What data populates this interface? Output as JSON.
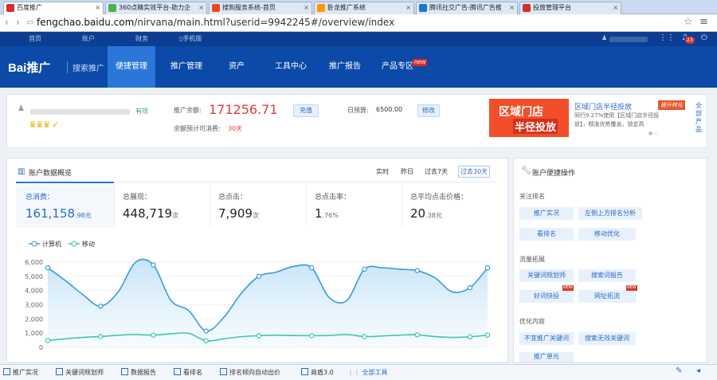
{
  "browser": {
    "tabs": [
      {
        "label": "百度推广",
        "fav": "#d32f2f"
      },
      {
        "label": "360点睛实效平台-助力企",
        "fav": "#4caf50"
      },
      {
        "label": "搜狗服务系统-首页",
        "fav": "#e64a19"
      },
      {
        "label": "卧龙推广系统",
        "fav": "#ff9800"
      },
      {
        "label": "腾讯社交广告-腾讯广告推",
        "fav": "#1976d2"
      },
      {
        "label": "投放管理平台",
        "fav": "#d32f2f"
      }
    ],
    "url_domain": "fengchao.baidu.com",
    "url_path": "/nirvana/main.html?userid=9942245#/overview/index"
  },
  "topnav": {
    "items": [
      "首页",
      "账户",
      "财务",
      "手机版"
    ],
    "notification_count": "23"
  },
  "mainnav": {
    "logo": "Bai推广",
    "logo_sub": "搜索推广",
    "items": [
      "便捷管理",
      "推广管理",
      "资产",
      "工具中心",
      "推广报告",
      "产品专区"
    ],
    "new_badge": "new"
  },
  "account": {
    "status": "有效",
    "balance_label": "推广余额:",
    "balance": "171256.71",
    "recharge_label": "充值",
    "est_label": "余额预计可消费:",
    "est_days": "30天",
    "budget_label": "日预算:",
    "budget": "6500.00",
    "modify_label": "修改"
  },
  "promo": {
    "banner_line1": "区域门店",
    "banner_line2": "半径投放",
    "title": "区域门店半径投放",
    "badge": "提升转化",
    "desc_line1": "同行9.27%使用【区域门店半径投",
    "desc_line2": "放】，精准优势覆盖，锁定高",
    "side_label": "全部产品"
  },
  "overview": {
    "title": "账户数据概览",
    "ranges": [
      "实时",
      "昨日",
      "过去7天",
      "过去30天"
    ],
    "stats": [
      {
        "label": "总消费：",
        "value": "161,158",
        "unit": ".98元"
      },
      {
        "label": "总展现：",
        "value": "448,719",
        "unit": "次"
      },
      {
        "label": "总点击：",
        "value": "7,909",
        "unit": "次"
      },
      {
        "label": "总点击率：",
        "value": "1",
        "unit": ".76%"
      },
      {
        "label": "总平均点击价格：",
        "value": "20",
        "unit": ".38元"
      }
    ]
  },
  "chart_data": {
    "type": "line",
    "series": [
      {
        "name": "计算机",
        "values": [
          5600,
          4700,
          3700,
          2900,
          3900,
          6000,
          5800,
          3300,
          2600,
          1150,
          2100,
          3800,
          5000,
          5300,
          5700,
          5600,
          3500,
          3300,
          5500,
          5600,
          5500,
          5400,
          4900,
          3900,
          4200,
          5600
        ]
      },
      {
        "name": "移动",
        "values": [
          480,
          600,
          700,
          760,
          850,
          900,
          860,
          950,
          990,
          460,
          600,
          750,
          820,
          860,
          830,
          820,
          840,
          900,
          760,
          800,
          860,
          880,
          760,
          700,
          740,
          860
        ]
      }
    ],
    "ylim": [
      0,
      6000
    ],
    "yticks": [
      "6,000",
      "5,000",
      "4,000",
      "3,000",
      "2,000",
      "1,000",
      "0"
    ],
    "grid": true,
    "legend": "top-left",
    "colors": [
      "#3a9ad9",
      "#3fc7a4"
    ]
  },
  "quick": {
    "title": "账户便捷操作",
    "sections": [
      {
        "title": "关注排名",
        "items": [
          "推广实况",
          "左侧上方排名分析",
          "看排名",
          "移动优化"
        ]
      },
      {
        "title": "流量拓展",
        "items": [
          "关键词规划师",
          "搜索词报告",
          "好词快投",
          "网址拓流"
        ]
      },
      {
        "title": "优化内容",
        "items": [
          "不宜推广关键词",
          "搜索无效关键词",
          "推广单元"
        ]
      }
    ],
    "new_badge": "NEW"
  },
  "bottombar": {
    "items": [
      "推广实况",
      "关键词规划师",
      "数据报告",
      "看排名",
      "排名倾向自动出价",
      "商盾3.0",
      "全部工具"
    ]
  }
}
